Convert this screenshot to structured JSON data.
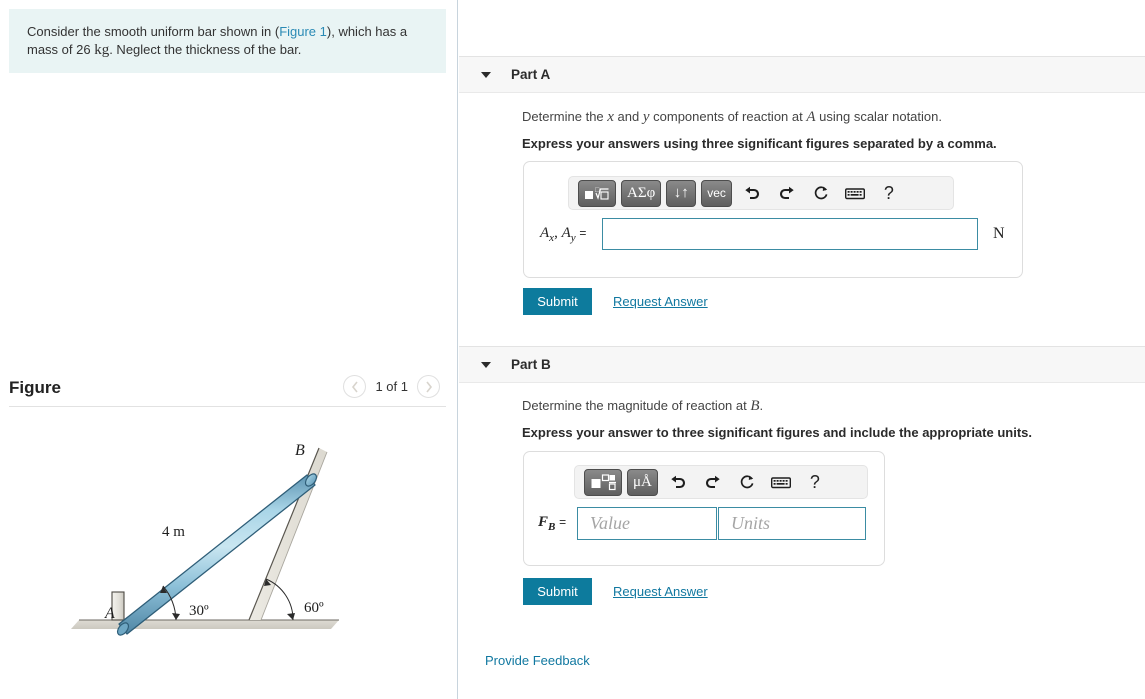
{
  "question": {
    "text_before_link": "Consider the smooth uniform bar shown in (",
    "link_label": "Figure 1",
    "text_after_link": "), which has a mass of 26 ",
    "mass_unit": "kg",
    "text_tail": ". Neglect the thickness of the bar."
  },
  "figure_panel": {
    "title": "Figure",
    "prev_icon": "chevron-left-icon",
    "next_icon": "chevron-right-icon",
    "counter": "1 of 1",
    "diagram": {
      "label_a": "A",
      "label_b": "B",
      "length_label": "4 m",
      "angle_ground": "30º",
      "angle_incline": "60º",
      "bar_color_light": "#bfe0ee",
      "bar_color_mid": "#7cb4d2",
      "bar_color_dark": "#4d8aa8",
      "ground_color": "#d8d5cd",
      "incline_color": "#e4e2da"
    }
  },
  "part_a": {
    "caret_icon": "caret-down-icon",
    "label": "Part A",
    "prompt_pre": "Determine the ",
    "prompt_x": "x",
    "prompt_mid": " and ",
    "prompt_y": "y",
    "prompt_post": " components of reaction at ",
    "prompt_a": "A",
    "prompt_tail": " using scalar notation.",
    "instruction": "Express your answers using three significant figures separated by a comma.",
    "toolbar": {
      "template_btn": "template-icon",
      "greek_btn": "ΑΣφ",
      "updown_btn": "↓↑",
      "vec_btn": "vec",
      "undo_icon": "undo-icon",
      "redo_icon": "redo-icon",
      "reset_icon": "reset-icon",
      "keyboard_icon": "keyboard-icon",
      "help_icon": "help-icon"
    },
    "answer_label_ax": "A",
    "answer_label_ax_sub": "x",
    "answer_label_ay": "A",
    "answer_label_ay_sub": "y",
    "answer_equals": "=",
    "answer_value": "",
    "answer_placeholder": "",
    "unit": "N",
    "submit_label": "Submit",
    "request_label": "Request Answer"
  },
  "part_b": {
    "caret_icon": "caret-down-icon",
    "label": "Part B",
    "prompt_pre": "Determine the magnitude of reaction at ",
    "prompt_b": "B",
    "prompt_tail": ".",
    "instruction": "Express your answer to three significant figures and include the appropriate units.",
    "toolbar": {
      "template_btn": "template-icon",
      "units_btn": "μÅ",
      "undo_icon": "undo-icon",
      "redo_icon": "redo-icon",
      "reset_icon": "reset-icon",
      "keyboard_icon": "keyboard-icon",
      "help_icon": "help-icon"
    },
    "answer_label_f": "F",
    "answer_label_f_sub": "B",
    "answer_equals": "=",
    "value_placeholder": "Value",
    "value_text": "",
    "units_placeholder": "Units",
    "units_text": "",
    "submit_label": "Submit",
    "request_label": "Request Answer"
  },
  "footer": {
    "feedback_label": "Provide Feedback"
  },
  "colors": {
    "accent_teal": "#0d7b9d",
    "link_blue": "#1178a0",
    "question_bg": "#e9f4f4",
    "header_bg": "#f7f7f7"
  }
}
